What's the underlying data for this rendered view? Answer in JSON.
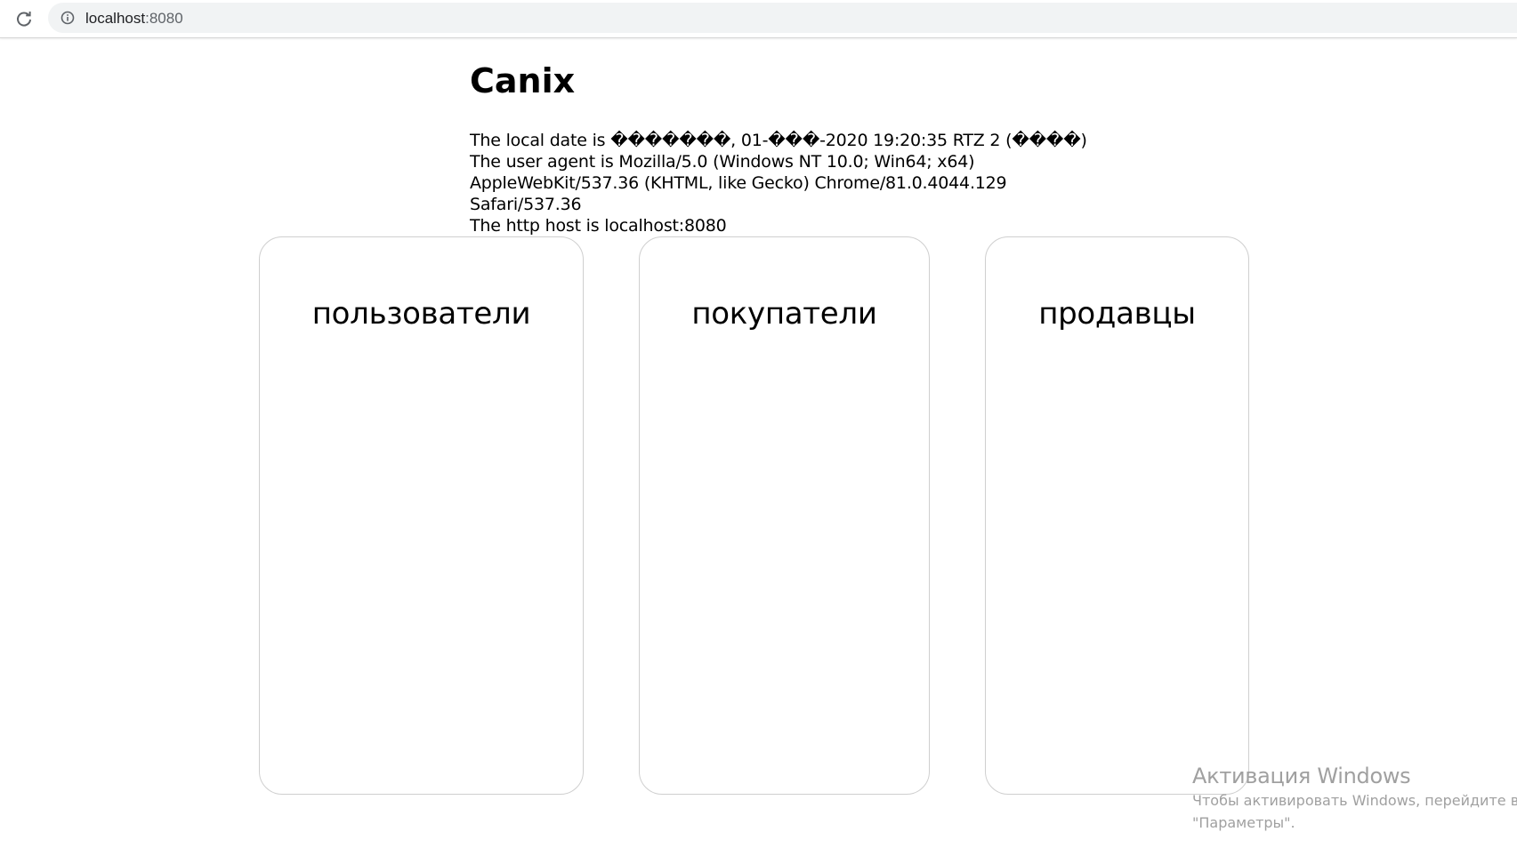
{
  "browser": {
    "url_host": "localhost",
    "url_port": ":8080",
    "icons": {
      "reload": "reload-icon",
      "info": "info-icon"
    }
  },
  "page": {
    "title": "Canix",
    "info_lines": {
      "local_date": "The local date is �������, 01-���-2020 19:20:35 RTZ 2 (����)",
      "user_agent": "The user agent is Mozilla/5.0 (Windows NT 10.0; Win64; x64) AppleWebKit/537.36 (KHTML, like Gecko) Chrome/81.0.4044.129 Safari/537.36",
      "http_host": "The http host is localhost:8080"
    }
  },
  "cards": {
    "users": "пользователи",
    "buyers": "покупатели",
    "sellers": "продавцы"
  },
  "watermark": {
    "title": "Активация Windows",
    "line1": "Чтобы активировать Windows, перейдите в р",
    "line2": "\"Параметры\"."
  }
}
